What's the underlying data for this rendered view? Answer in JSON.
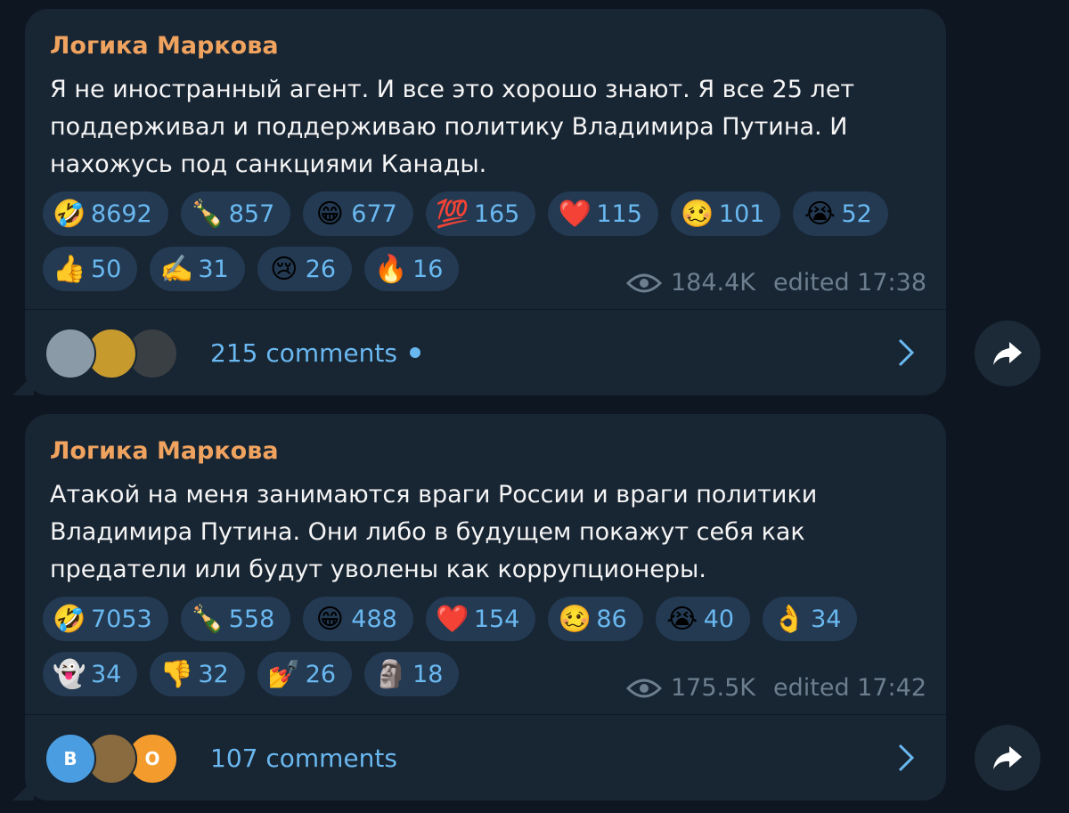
{
  "posts": [
    {
      "author": "Логика Маркова",
      "text": "Я не иностранный агент. И все это хорошо знают. Я все 25 лет поддерживал и поддерживаю политику Владимира Путина. И нахожусь под санкциями Канады.",
      "reactions_row1": [
        {
          "emoji": "🤣",
          "icon": "rofl-icon",
          "count": "8692"
        },
        {
          "emoji": "🍾",
          "icon": "champagne-icon",
          "count": "857"
        },
        {
          "emoji": "😁",
          "icon": "grin-icon",
          "count": "677"
        },
        {
          "emoji": "💯",
          "icon": "hundred-icon",
          "count": "165"
        },
        {
          "emoji": "❤️",
          "icon": "heart-icon",
          "count": "115"
        },
        {
          "emoji": "🥴",
          "icon": "woozy-icon",
          "count": "101"
        },
        {
          "emoji": "😭",
          "icon": "sob-icon",
          "count": "52"
        }
      ],
      "reactions_row2": [
        {
          "emoji": "👍",
          "icon": "thumbs-up-icon",
          "count": "50"
        },
        {
          "emoji": "✍️",
          "icon": "writing-hand-icon",
          "count": "31"
        },
        {
          "emoji": "😢",
          "icon": "cry-icon",
          "count": "26"
        },
        {
          "emoji": "🔥",
          "icon": "fire-icon",
          "count": "16"
        }
      ],
      "views": "184.4K",
      "edited": "edited 17:38",
      "comments_label": "215 comments",
      "unread_dot": true,
      "avatars": [
        {
          "letter": "",
          "color": "#8a9aa6"
        },
        {
          "letter": "",
          "color": "#c79a2e"
        },
        {
          "letter": "",
          "color": "#3a3f44"
        }
      ]
    },
    {
      "author": "Логика Маркова",
      "text": "Атакой на меня занимаются враги России и враги политики Владимира Путина. Они либо в будущем покажут себя как предатели или будут уволены как коррупционеры.",
      "reactions_row1": [
        {
          "emoji": "🤣",
          "icon": "rofl-icon",
          "count": "7053"
        },
        {
          "emoji": "🍾",
          "icon": "champagne-icon",
          "count": "558"
        },
        {
          "emoji": "😁",
          "icon": "grin-icon",
          "count": "488"
        },
        {
          "emoji": "❤️",
          "icon": "heart-icon",
          "count": "154"
        },
        {
          "emoji": "🥴",
          "icon": "woozy-icon",
          "count": "86"
        },
        {
          "emoji": "😭",
          "icon": "sob-icon",
          "count": "40"
        },
        {
          "emoji": "👌",
          "icon": "ok-hand-icon",
          "count": "34"
        }
      ],
      "reactions_row2": [
        {
          "emoji": "👻",
          "icon": "ghost-icon",
          "count": "34"
        },
        {
          "emoji": "👎",
          "icon": "thumbs-down-icon",
          "count": "32"
        },
        {
          "emoji": "💅",
          "icon": "nail-polish-icon",
          "count": "26"
        },
        {
          "emoji": "🗿",
          "icon": "moai-icon",
          "count": "18"
        }
      ],
      "views": "175.5K",
      "edited": "edited 17:42",
      "comments_label": "107 comments",
      "unread_dot": false,
      "avatars": [
        {
          "letter": "B",
          "color": "#4a9de0"
        },
        {
          "letter": "",
          "color": "#8a6b3f"
        },
        {
          "letter": "O",
          "color": "#f39b2c"
        }
      ]
    }
  ],
  "colors": {
    "background": "#0e1621",
    "bubble": "#182533",
    "author": "#f0a35f",
    "accent": "#6ab8f0",
    "meta": "#6d7f8f"
  }
}
